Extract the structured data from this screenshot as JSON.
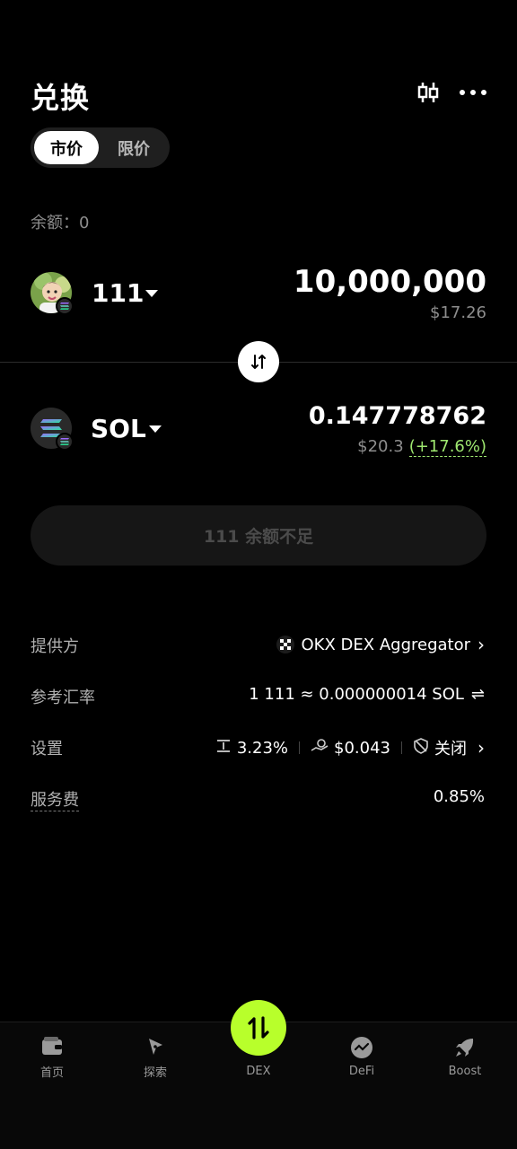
{
  "header": {
    "title": "兑换",
    "candle_icon": "candlestick-icon",
    "more_icon": "more-dots-icon"
  },
  "tabs": [
    {
      "label": "市价",
      "active": true
    },
    {
      "label": "限价",
      "active": false
    }
  ],
  "balance_text": "余额：0",
  "from_token": {
    "symbol": "111",
    "amount": "10,000,000",
    "fiat": "$17.26",
    "chain_badge_icon": "solana-icon"
  },
  "to_token": {
    "symbol": "SOL",
    "amount": "0.147778762",
    "fiat": "$20.3",
    "change": "(+17.6%)",
    "chain_badge_icon": "solana-icon"
  },
  "swap_icon": "swap-arrows-icon",
  "main_button_label": "111 余额不足",
  "info": {
    "provider_label": "提供方",
    "provider_value": "OKX DEX Aggregator",
    "rate_label": "参考汇率",
    "rate_value": "1 111 ≈ 0.000000014 SOL",
    "rate_toggle_glyph": "⇌",
    "settings_label": "设置",
    "slippage": "3.23%",
    "gas": "$0.043",
    "mev_protect": "关闭",
    "fee_label": "服务费",
    "fee_value": "0.85%"
  },
  "nav": [
    {
      "label": "首页",
      "icon": "wallet-icon"
    },
    {
      "label": "探索",
      "icon": "compass-icon"
    },
    {
      "label": "DEX",
      "icon": "swap-vertical-icon"
    },
    {
      "label": "DeFi",
      "icon": "defi-chart-icon"
    },
    {
      "label": "Boost",
      "icon": "rocket-icon"
    }
  ],
  "colors": {
    "accent": "#b8ff2b",
    "positive": "#9fe870",
    "background": "#000000"
  }
}
